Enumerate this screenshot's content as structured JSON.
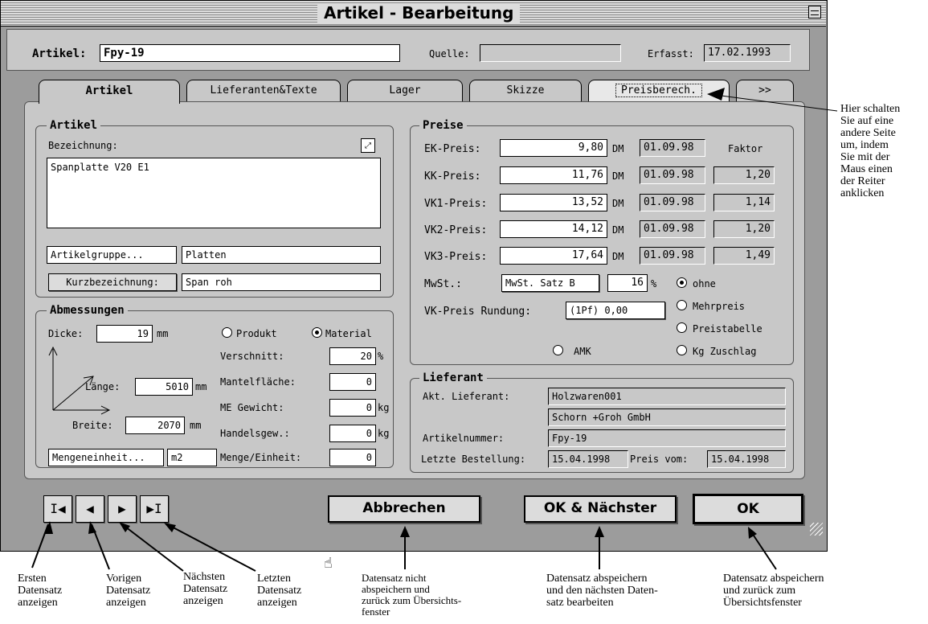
{
  "window": {
    "title": "Artikel - Bearbeitung"
  },
  "header": {
    "artikel_label": "Artikel:",
    "artikel_value": "Fpy-19",
    "quelle_label": "Quelle:",
    "quelle_value": "",
    "erfasst_label": "Erfasst:",
    "erfasst_value": "17.02.1993"
  },
  "tabs": [
    {
      "label": "Artikel"
    },
    {
      "label": "Lieferanten&Texte"
    },
    {
      "label": "Lager"
    },
    {
      "label": "Skizze"
    },
    {
      "label": "Preisberech."
    },
    {
      "label": ">>"
    }
  ],
  "artikel_group": {
    "title": "Artikel",
    "bezeichnung_label": "Bezeichnung:",
    "bezeichnung_value": "Spanplatte V20 E1",
    "gruppe_button": "Artikelgruppe...",
    "gruppe_value": "Platten",
    "kurz_button": "Kurzbezeichnung:",
    "kurz_value": "Span roh"
  },
  "abmessungen": {
    "title": "Abmessungen",
    "dicke_label": "Dicke:",
    "dicke_value": "19",
    "dicke_unit": "mm",
    "laenge_label": "Länge:",
    "laenge_value": "5010",
    "laenge_unit": "mm",
    "breite_label": "Breite:",
    "breite_value": "2070",
    "breite_unit": "mm",
    "produkt_label": "Produkt",
    "material_label": "Material",
    "verschnitt_label": "Verschnitt:",
    "verschnitt_value": "20",
    "verschnitt_unit": "%",
    "mantel_label": "Mantelfläche:",
    "mantel_value": "0",
    "me_label": "ME Gewicht:",
    "me_value": "0",
    "me_unit": "kg",
    "handel_label": "Handelsgew.:",
    "handel_value": "0",
    "handel_unit": "kg",
    "menge_button": "Mengeneinheit...",
    "menge_value": "m2",
    "meinheit_label": "Menge/Einheit:",
    "meinheit_value": "0"
  },
  "preise": {
    "title": "Preise",
    "faktor_label": "Faktor",
    "rows": [
      {
        "label": "EK-Preis:",
        "value": "9,80",
        "cur": "DM",
        "date": "01.09.98",
        "faktor": ""
      },
      {
        "label": "KK-Preis:",
        "value": "11,76",
        "cur": "DM",
        "date": "01.09.98",
        "faktor": "1,20"
      },
      {
        "label": "VK1-Preis:",
        "value": "13,52",
        "cur": "DM",
        "date": "01.09.98",
        "faktor": "1,14"
      },
      {
        "label": "VK2-Preis:",
        "value": "14,12",
        "cur": "DM",
        "date": "01.09.98",
        "faktor": "1,20"
      },
      {
        "label": "VK3-Preis:",
        "value": "17,64",
        "cur": "DM",
        "date": "01.09.98",
        "faktor": "1,49"
      }
    ],
    "mwst_label": "MwSt.:",
    "mwst_value": "MwSt. Satz B",
    "mwst_pct": "16",
    "pct_sign": "%",
    "rund_label": "VK-Preis Rundung:",
    "rund_value": "(1Pf)  0,00",
    "opt_ohne": "ohne",
    "opt_mehr": "Mehrpreis",
    "opt_tabelle": "Preistabelle",
    "opt_kg": "Kg Zuschlag",
    "opt_amk": "AMK"
  },
  "lieferant": {
    "title": "Lieferant",
    "akt_label": "Akt. Lieferant:",
    "akt_value": "Holzwaren001",
    "name_value": "Schorn +Groh GmbH",
    "nr_label": "Artikelnummer:",
    "nr_value": "Fpy-19",
    "best_label": "Letzte Bestellung:",
    "best_value": "15.04.1998",
    "preis_label": "Preis vom:",
    "preis_value": "15.04.1998"
  },
  "buttons": {
    "abbrechen": "Abbrechen",
    "ok_next": "OK & Nächster",
    "ok": "OK"
  },
  "nav": {
    "first": "I◀",
    "prev": "◀",
    "next": "▶",
    "last": "▶I"
  },
  "notes": {
    "tab_hint": [
      "Hier schalten",
      "Sie auf eine",
      "andere Seite",
      "um, indem",
      "Sie mit der",
      "Maus einen",
      "der Reiter",
      "anklicken"
    ],
    "first": [
      "Ersten",
      "Datensatz",
      "anzeigen"
    ],
    "prev": [
      "Vorigen",
      "Datensatz",
      "anzeigen"
    ],
    "next": [
      "Nächsten",
      "Datensatz",
      "anzeigen"
    ],
    "last": [
      "Letzten",
      "Datensatz",
      "anzeigen"
    ],
    "abbrechen": [
      "Datensatz nicht",
      "abspeichern und",
      "zurück zum Übersichts-",
      "fenster"
    ],
    "ok_next": [
      "Datensatz abspeichern",
      "und den nächsten Daten-",
      "satz bearbeiten"
    ],
    "ok": [
      "Datensatz abspeichern",
      "und zurück zum",
      "Übersichtsfenster"
    ]
  }
}
